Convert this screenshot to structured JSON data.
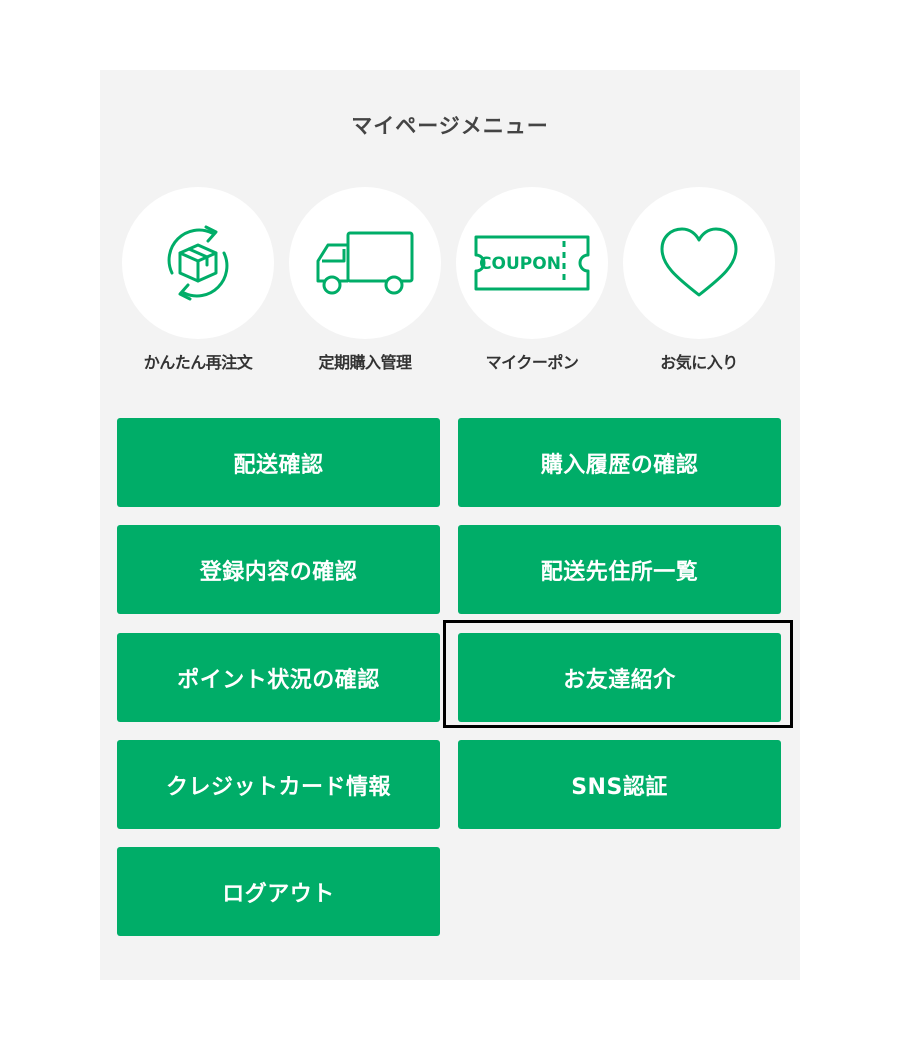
{
  "menu": {
    "title": "マイページメニュー",
    "icons": [
      {
        "label": "かんたん再注文",
        "icon": "reorder-box-icon"
      },
      {
        "label": "定期購入管理",
        "icon": "truck-icon"
      },
      {
        "label": "マイクーポン",
        "icon": "coupon-icon",
        "icon_text": "COUPON"
      },
      {
        "label": "お気に入り",
        "icon": "heart-icon"
      }
    ],
    "buttons": [
      {
        "label": "配送確認"
      },
      {
        "label": "購入履歴の確認"
      },
      {
        "label": "登録内容の確認"
      },
      {
        "label": "配送先住所一覧"
      },
      {
        "label": "ポイント状況の確認"
      },
      {
        "label": "お友達紹介",
        "highlighted": true
      },
      {
        "label": "クレジットカード情報"
      },
      {
        "label": "SNS認証"
      },
      {
        "label": "ログアウト"
      }
    ]
  },
  "colors": {
    "accent": "#00ad68",
    "panel_background": "#f3f3f3",
    "highlight_border": "#000000"
  }
}
